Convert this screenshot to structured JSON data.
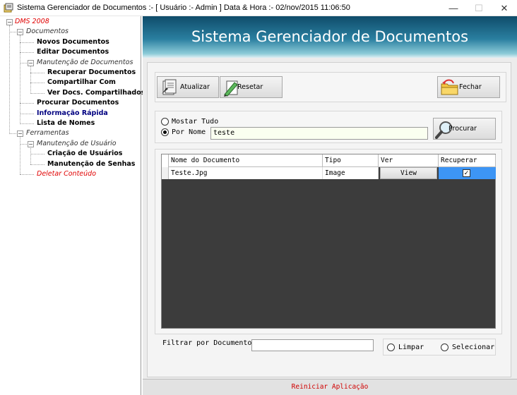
{
  "window": {
    "title": "Sistema Gerenciador de Documentos :- [ Usuário :- Admin ]  Data & Hora :- 02/nov/2015 11:06:50",
    "minimize_glyph": "—",
    "maximize_glyph": "☐",
    "close_glyph": "✕"
  },
  "tree": {
    "root": "DMS 2008",
    "documentos": "Documentos",
    "novos": "Novos Documentos",
    "editar": "Editar Documentos",
    "manutencao_docs": "Manutenção de Documentos",
    "recuperar": "Recuperar Documentos",
    "compartilhar": "Compartilhar Com",
    "ver_compartilhados": "Ver Docs. Compartilhados",
    "procurar": "Procurar Documentos",
    "informacao": "Informação Rápida",
    "lista": "Lista de Nomes",
    "ferramentas": "Ferramentas",
    "manutencao_usuario": "Manutenção de Usuário",
    "criacao": "Criação de Usuários",
    "senhas": "Manutenção de Senhas",
    "deletar": "Deletar Conteúdo",
    "expander_minus": "−"
  },
  "header": {
    "title": "Sistema Gerenciador de Documentos"
  },
  "toolbar": {
    "atualizar": "Atualizar",
    "resetar": "Resetar",
    "fechar": "Fechar"
  },
  "search": {
    "mostrar_tudo": "Mostar Tudo",
    "por_nome": "Por Nome",
    "value": "teste",
    "procurar": "Procurar",
    "selected_option": "Por Nome"
  },
  "grid": {
    "columns": [
      "Nome do Documento",
      "Tipo",
      "Ver",
      "Recuperar"
    ],
    "rows": [
      {
        "nome": "Teste.Jpg",
        "tipo": "Image",
        "ver": "View",
        "recuperar_checked": true
      }
    ],
    "check_glyph": "✓"
  },
  "filter": {
    "label": "Filtrar por Documento",
    "value": "",
    "limpar": "Limpar",
    "selecionar": "Selecionar"
  },
  "status": {
    "text": "Reiniciar Aplicação"
  },
  "colors": {
    "header_dark": "#0f4c6a",
    "selection": "#3d95f5",
    "grid_background": "#3c3c3c",
    "tree_red": "#e00000",
    "tree_blue": "#000080"
  }
}
